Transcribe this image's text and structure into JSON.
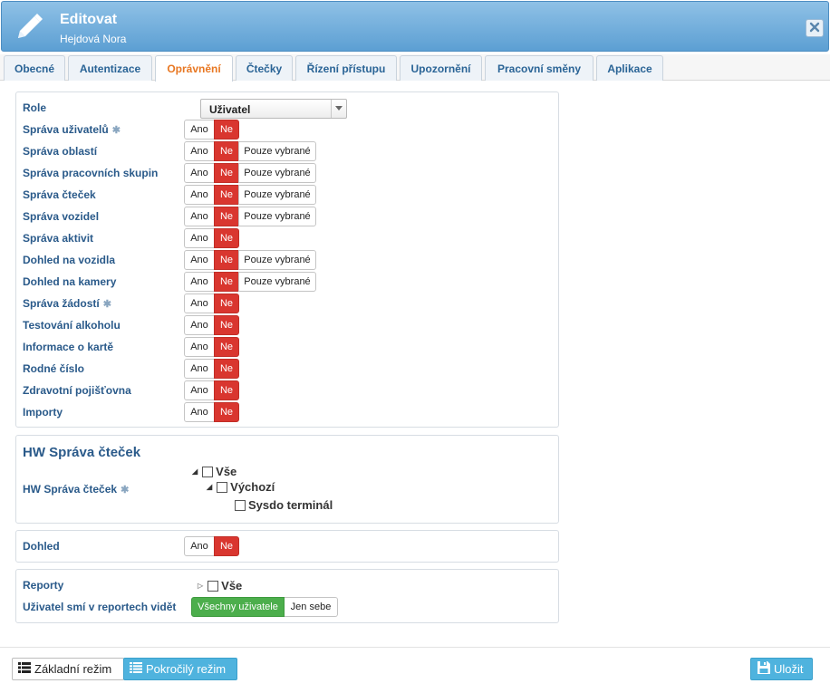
{
  "header": {
    "title": "Editovat",
    "subtitle": "Hejdová Nora"
  },
  "tabs": [
    {
      "label": "Obecné"
    },
    {
      "label": "Autentizace"
    },
    {
      "label": "Oprávnění"
    },
    {
      "label": "Čtečky"
    },
    {
      "label": "Řízení přístupu"
    },
    {
      "label": "Upozornění"
    },
    {
      "label": "Pracovní směny"
    },
    {
      "label": "Aplikace"
    }
  ],
  "active_tab": "Oprávnění",
  "segment": {
    "yes": "Ano",
    "no": "Ne",
    "selected_only": "Pouze vybrané"
  },
  "role": {
    "label": "Role",
    "value": "Uživatel"
  },
  "permissions": [
    {
      "label": "Správa uživatelů",
      "asterisk": true,
      "state": "Ne"
    },
    {
      "label": "Správa oblastí",
      "state": "Ne"
    },
    {
      "label": "Správa pracovních skupin",
      "state": "Ne"
    },
    {
      "label": "Správa čteček",
      "state": "Ne"
    },
    {
      "label": "Správa vozidel",
      "state": "Ne"
    },
    {
      "label": "Správa aktivit",
      "state": "Ne"
    },
    {
      "label": "Dohled na vozidla",
      "state": "Ne"
    },
    {
      "label": "Dohled na kamery",
      "state": "Ne"
    },
    {
      "label": "Správa žádostí",
      "asterisk": true,
      "state": "Ne"
    },
    {
      "label": "Testování alkoholu",
      "state": "Ne"
    },
    {
      "label": "Informace o kartě",
      "state": "Ne"
    },
    {
      "label": "Rodné číslo",
      "state": "Ne"
    },
    {
      "label": "Zdravotní pojišťovna",
      "state": "Ne"
    },
    {
      "label": "Importy",
      "state": "Ne"
    }
  ],
  "hw": {
    "title": "HW Správa čteček",
    "label": "HW Správa čteček",
    "tree": [
      "Vše",
      "Výchozí",
      "Sysdo terminál"
    ]
  },
  "dohled": {
    "label": "Dohled",
    "state": "Ne"
  },
  "reports": {
    "label": "Reporty",
    "tree_all": "Vše",
    "visibility_label": "Uživatel smí v reportech vidět",
    "option_all": "Všechny uživatele",
    "option_self": "Jen sebe",
    "selected": "Všechny uživatele"
  },
  "footer": {
    "basic_mode": "Základní režim",
    "advanced_mode": "Pokročilý režim",
    "save": "Uložit"
  }
}
